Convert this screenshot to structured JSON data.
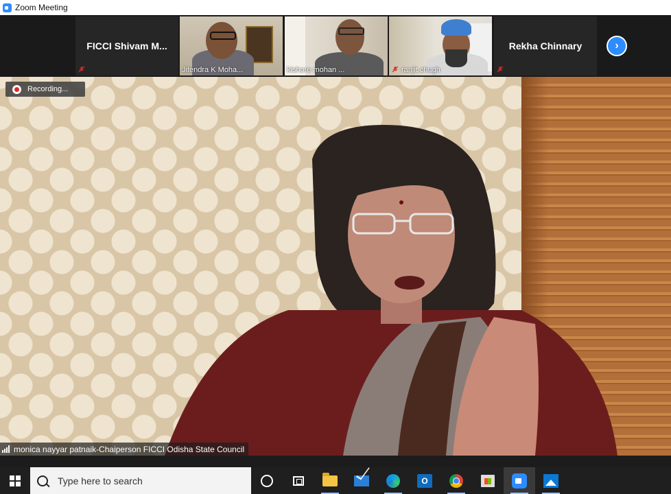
{
  "window": {
    "title": "Zoom Meeting"
  },
  "participants": [
    {
      "name": "FICCI  Shivam  M...",
      "muted": true,
      "video": false
    },
    {
      "name": "Jitendra K Moha...",
      "muted": false,
      "video": true
    },
    {
      "name": "kishore mohan ...",
      "muted": false,
      "video": true
    },
    {
      "name": "ranjit.chugh",
      "muted": true,
      "video": true
    },
    {
      "name": "Rekha Chinnary",
      "muted": true,
      "video": false
    }
  ],
  "recording": {
    "label": "Recording..."
  },
  "active_speaker": {
    "name": "monica nayyar patnaik-Chaiperson FICCI Odisha State Council"
  },
  "taskbar": {
    "search_placeholder": "Type here to search",
    "apps": [
      "task-view",
      "file-explorer",
      "mail",
      "edge",
      "outlook",
      "chrome",
      "store",
      "zoom",
      "photos"
    ]
  },
  "colors": {
    "zoom_blue": "#2D8CFF",
    "mute_red": "#e02828",
    "taskbar": "#1f1f1f"
  }
}
